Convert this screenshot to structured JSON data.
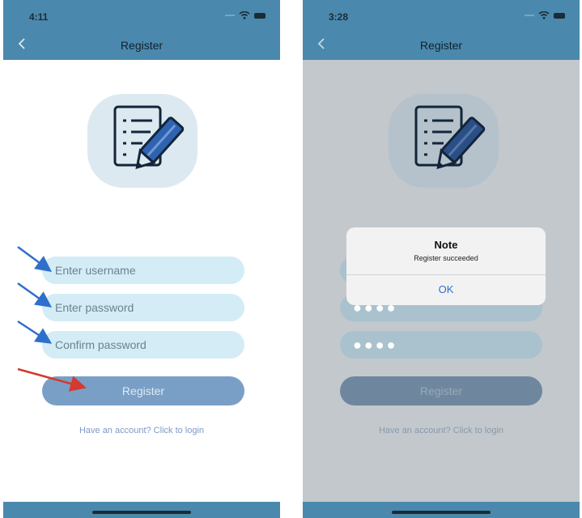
{
  "left": {
    "status": {
      "time": "4:11"
    },
    "nav": {
      "title": "Register"
    },
    "fields": {
      "username_placeholder": "Enter username",
      "password_placeholder": "Enter password",
      "confirm_placeholder": "Confirm password"
    },
    "register_label": "Register",
    "login_link": "Have an account? Click to login"
  },
  "right": {
    "status": {
      "time": "3:28"
    },
    "nav": {
      "title": "Register"
    },
    "fields": {
      "username_value": "",
      "password_dots": "●●●●",
      "confirm_dots": "●●●●"
    },
    "register_label": "Register",
    "login_link": "Have an account? Click to login",
    "alert": {
      "title": "Note",
      "message": "Register succeeded",
      "ok_label": "OK"
    }
  },
  "colors": {
    "header_blue": "#4a89ad",
    "field_bg": "#d4ecf5",
    "button_blue": "#7a9fc6",
    "annotation_blue_arrow": "#2f6fcc",
    "annotation_red_arrow": "#d43a2e",
    "alert_ok": "#2f6fd1"
  },
  "icons": [
    "back-chevron-icon",
    "wifi-icon",
    "battery-icon",
    "register-form-pencil-icon"
  ]
}
